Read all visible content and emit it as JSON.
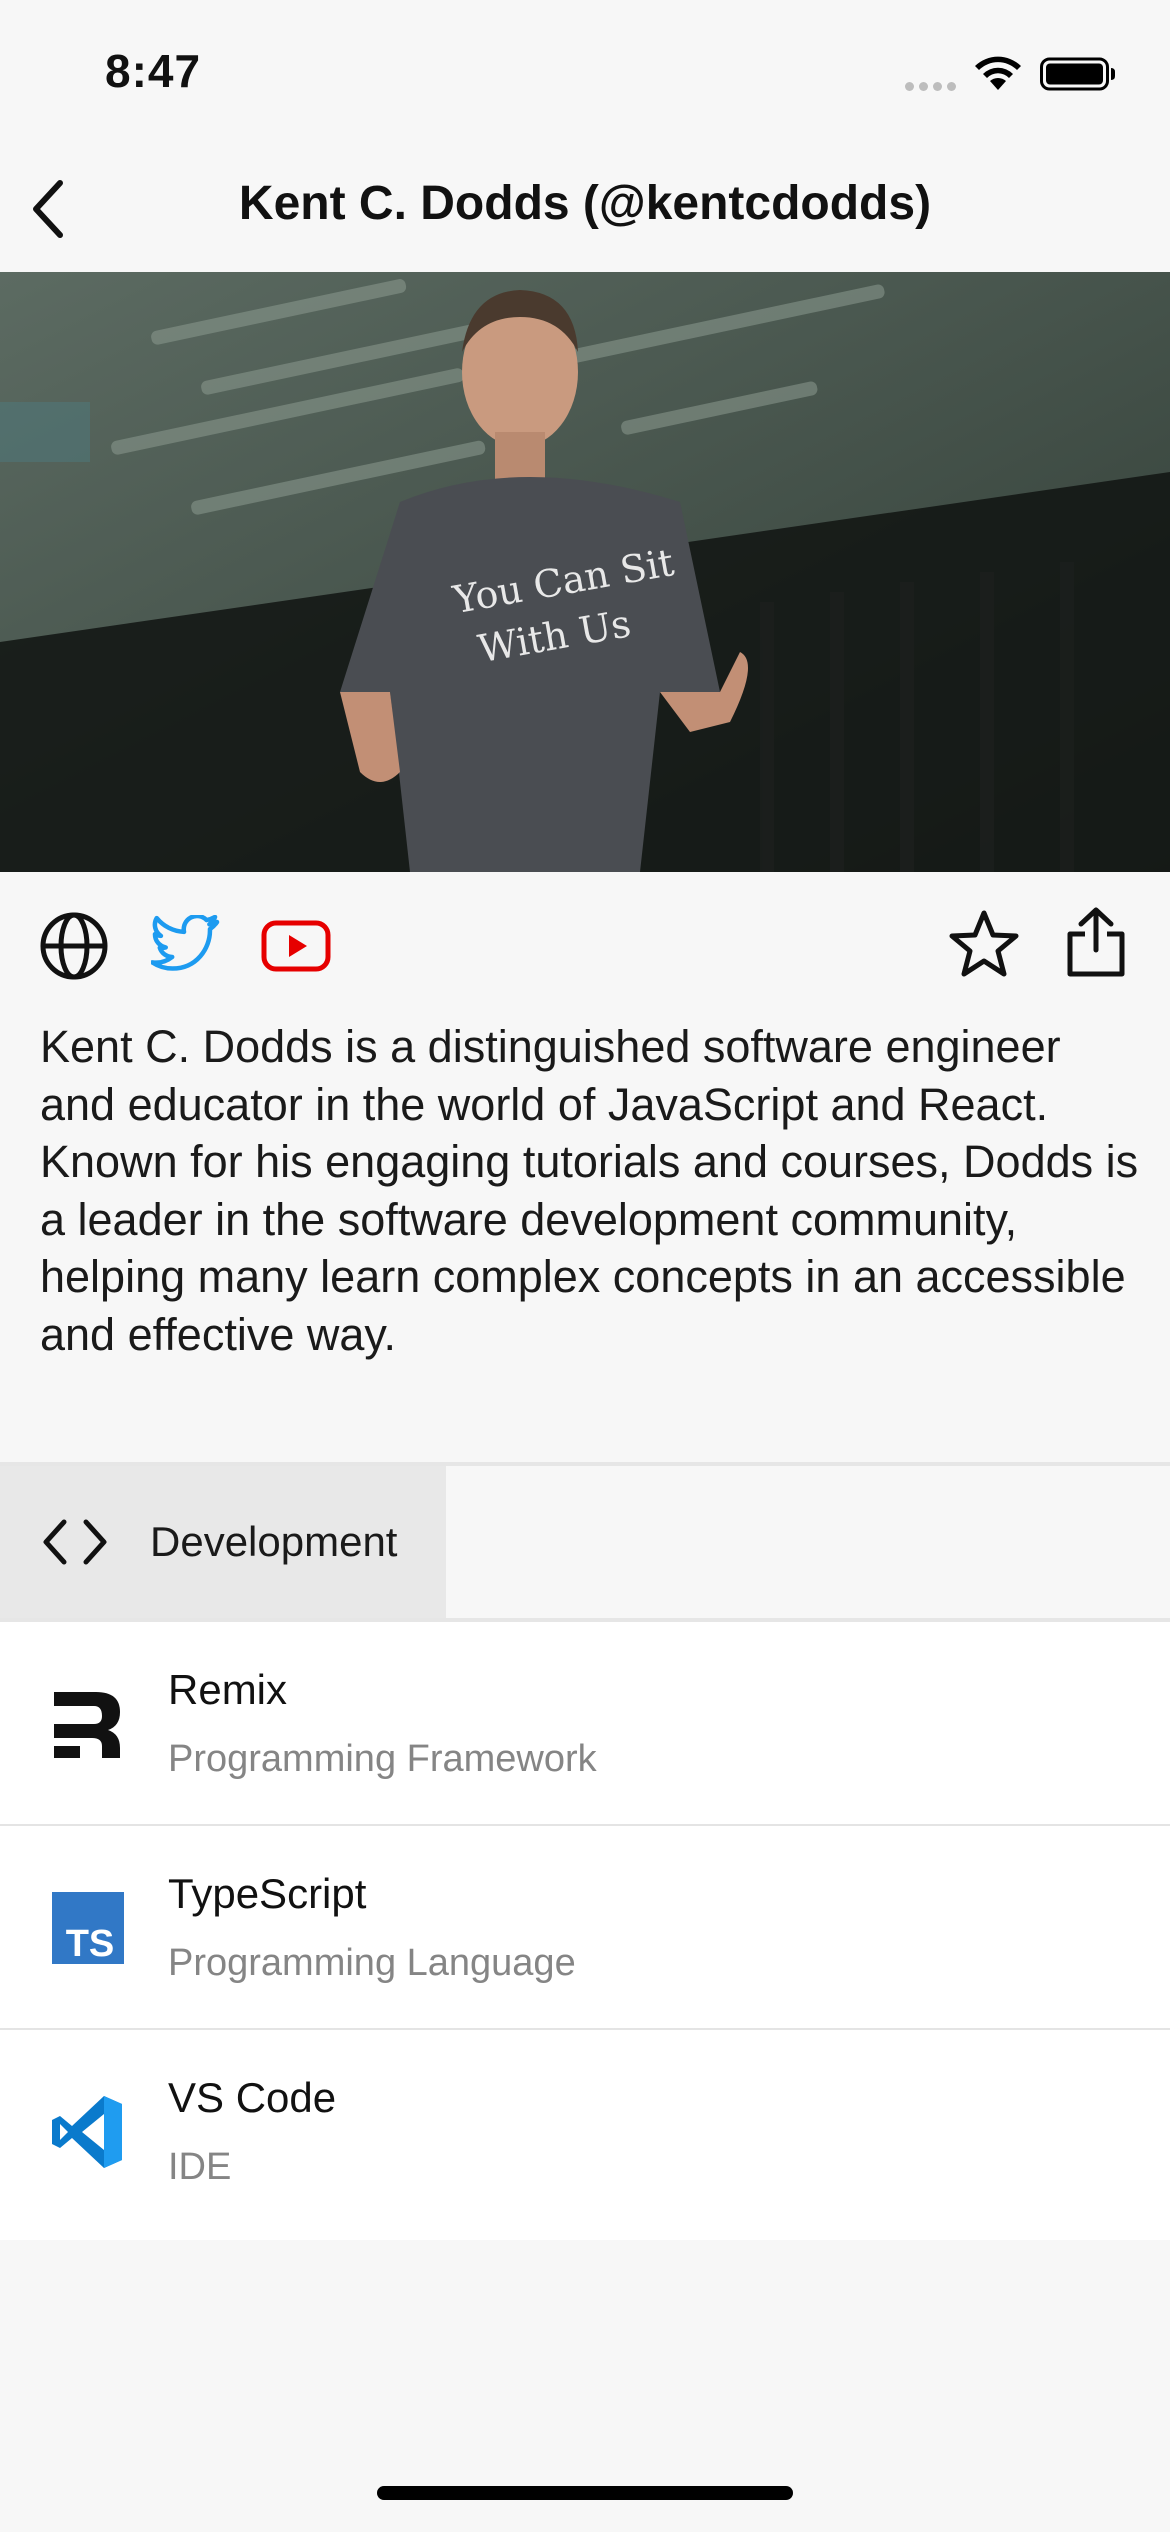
{
  "status_bar": {
    "time": "8:47"
  },
  "nav": {
    "title": "Kent C. Dodds (@kentcdodds)",
    "back_icon": "chevron-left-icon"
  },
  "hero": {
    "description": "Stage photo of Kent C. Dodds speaking, wearing a grey t-shirt",
    "shirt_text_line1": "You Can Sit",
    "shirt_text_line2": "With Us"
  },
  "actions": {
    "links": [
      {
        "icon": "globe-icon",
        "color": "#111111"
      },
      {
        "icon": "twitter-icon",
        "color": "#1d9bf0"
      },
      {
        "icon": "youtube-icon",
        "color": "#e60000"
      }
    ],
    "favorite_icon": "star-icon",
    "share_icon": "share-icon"
  },
  "description": "Kent C. Dodds is a distinguished software engineer and educator in the world of JavaScript and React. Known for his engaging tutorials and courses, Dodds is a leader in the software development community, helping many learn complex concepts in an accessible and effective way.",
  "category": {
    "icon": "code-icon",
    "label": "Development"
  },
  "tools": [
    {
      "name": "Remix",
      "type": "Programming Framework",
      "logo": "remix-logo"
    },
    {
      "name": "TypeScript",
      "type": "Programming Language",
      "logo": "typescript-logo",
      "logo_text": "TS",
      "color": "#3178c6"
    },
    {
      "name": "VS Code",
      "type": "IDE",
      "logo": "vscode-logo",
      "color": "#0a7acc"
    }
  ]
}
